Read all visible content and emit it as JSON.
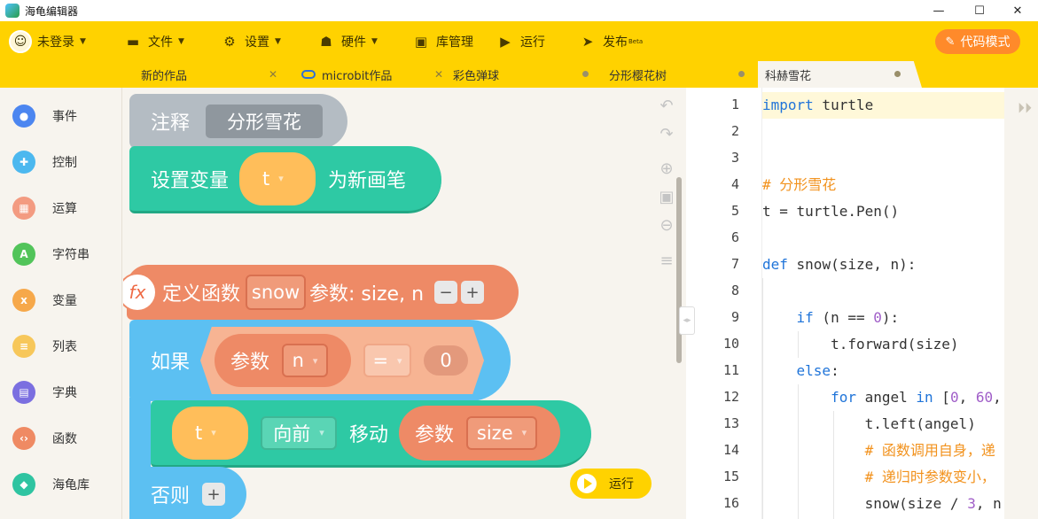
{
  "window": {
    "title": "海龟编辑器",
    "controls": {
      "minimize": "—",
      "maximize": "☐",
      "close": "✕"
    }
  },
  "menu": {
    "user": "未登录",
    "file": "文件",
    "settings": "设置",
    "hardware": "硬件",
    "library": "库管理",
    "run": "运行",
    "publish": "发布",
    "publish_badge": "Beta",
    "code_mode": "代码模式",
    "colors": {
      "bar": "#ffd200",
      "code_mode": "#ff8a2a"
    }
  },
  "tabs": [
    {
      "label": "新的作品",
      "state": "close"
    },
    {
      "label": "microbit作品",
      "state": "close"
    },
    {
      "label": "彩色弹球",
      "state": "dot"
    },
    {
      "label": "分形樱花树",
      "state": "dot"
    },
    {
      "label": "科赫雪花",
      "state": "dot",
      "active": true
    }
  ],
  "categories": [
    {
      "label": "事件",
      "color": "#4c86f0",
      "icon": "toggle-icon"
    },
    {
      "label": "控制",
      "color": "#4cb8ef",
      "icon": "gamepad-icon"
    },
    {
      "label": "运算",
      "color": "#f39b81",
      "icon": "calculator-icon"
    },
    {
      "label": "字符串",
      "color": "#52c45a",
      "icon": "string-icon"
    },
    {
      "label": "变量",
      "color": "#f6a84a",
      "icon": "variable-icon"
    },
    {
      "label": "列表",
      "color": "#f7c75a",
      "icon": "list-icon"
    },
    {
      "label": "字典",
      "color": "#7b6fe0",
      "icon": "book-icon"
    },
    {
      "label": "函数",
      "color": "#ef8a63",
      "icon": "function-icon"
    },
    {
      "label": "海龟库",
      "color": "#2fc4a1",
      "icon": "turtle-icon"
    }
  ],
  "blocks": {
    "comment": {
      "label": "注释",
      "value": "分形雪花"
    },
    "set_var": {
      "label": "设置变量",
      "var": "t",
      "suffix": "为新画笔"
    },
    "def_func": {
      "fx": "fx",
      "label": "定义函数",
      "name": "snow",
      "params_label": "参数: size, n",
      "minus": "−",
      "plus": "+"
    },
    "if": {
      "label": "如果",
      "param_label": "参数",
      "param": "n",
      "op": "=",
      "value": "0"
    },
    "move": {
      "var": "t",
      "dir": "向前",
      "action": "移动",
      "param_label": "参数",
      "param": "size"
    },
    "else": {
      "label": "否则",
      "plus": "+"
    },
    "run_button": "运行"
  },
  "code": {
    "line_numbers": [
      "1",
      "2",
      "3",
      "4",
      "5",
      "6",
      "7",
      "8",
      "9",
      "10",
      "11",
      "12",
      "13",
      "14",
      "15",
      "16"
    ]
  }
}
